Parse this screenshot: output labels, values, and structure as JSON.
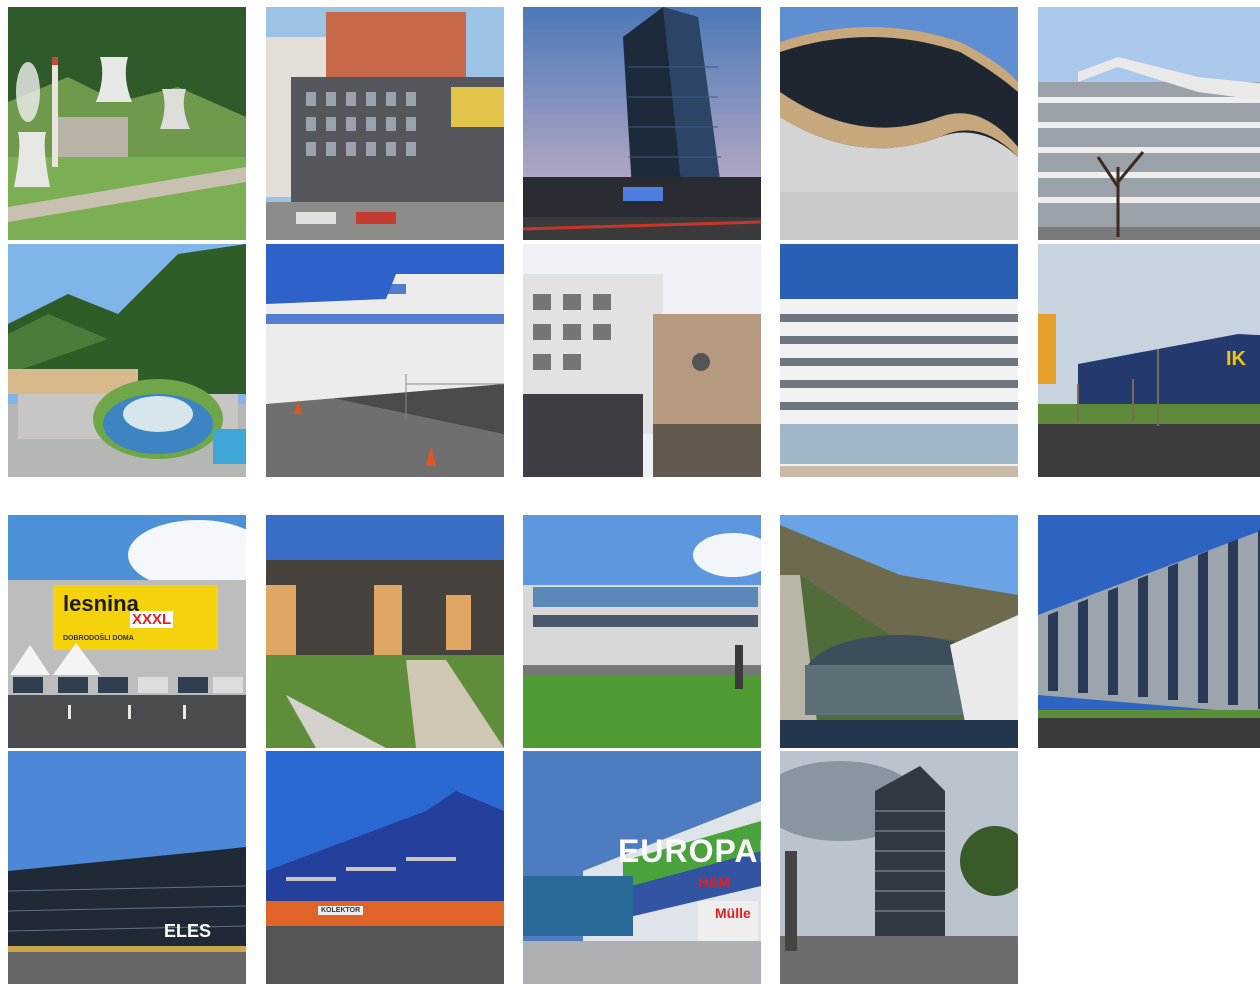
{
  "gallery": {
    "tiles": [
      {
        "id": 1,
        "subject": "thermal power plant with cooling towers in a green valley"
      },
      {
        "id": 2,
        "subject": "modern residential block with orange upper floors"
      },
      {
        "id": 3,
        "subject": "glass office tower at dusk"
      },
      {
        "id": 4,
        "subject": "wavy roof arena facade"
      },
      {
        "id": 5,
        "subject": "apartment building with white balconies"
      },
      {
        "id": 6,
        "subject": "spa resort with glass dome below a forested hill"
      },
      {
        "id": 7,
        "subject": "white industrial hall with windows strip"
      },
      {
        "id": 8,
        "subject": "white and beige office buildings"
      },
      {
        "id": 9,
        "subject": "curved white residential building"
      },
      {
        "id": 10,
        "subject": "blue store building with yellow sign"
      },
      {
        "id": 11,
        "subject": "furniture store with yellow sign and parked cars"
      },
      {
        "id": 12,
        "subject": "residential buildings with wooden facades and lawn"
      },
      {
        "id": 13,
        "subject": "glass faculty building with lawn"
      },
      {
        "id": 14,
        "subject": "ski jump building with round glass structure"
      },
      {
        "id": 15,
        "subject": "glass and metal stripe facade"
      },
      {
        "id": 16,
        "subject": "long glass office building with company name"
      },
      {
        "id": 17,
        "subject": "blue industrial hall"
      },
      {
        "id": 18,
        "subject": "shopping mall with large branded sign"
      },
      {
        "id": 19,
        "subject": "high-rise glass tower near road"
      }
    ]
  },
  "signs": {
    "ikea": "IK",
    "lesnina": "lesnina",
    "xxxl": "XXXL",
    "dobrodosli": "DOBRODOŠLI DOMA",
    "eles": "ELES",
    "kolektor": "KOLEKTOR",
    "europark": "EUROPARK",
    "hm": "H&M",
    "muller": "Mülle"
  },
  "colors": {
    "sky": "#7fa6d6",
    "green": "#4f8a3a",
    "ikea_blue": "#243a6e",
    "ikea_yellow": "#f5c400",
    "lesnina_yellow": "#f4d20c",
    "europark_green": "#4aa23c"
  }
}
